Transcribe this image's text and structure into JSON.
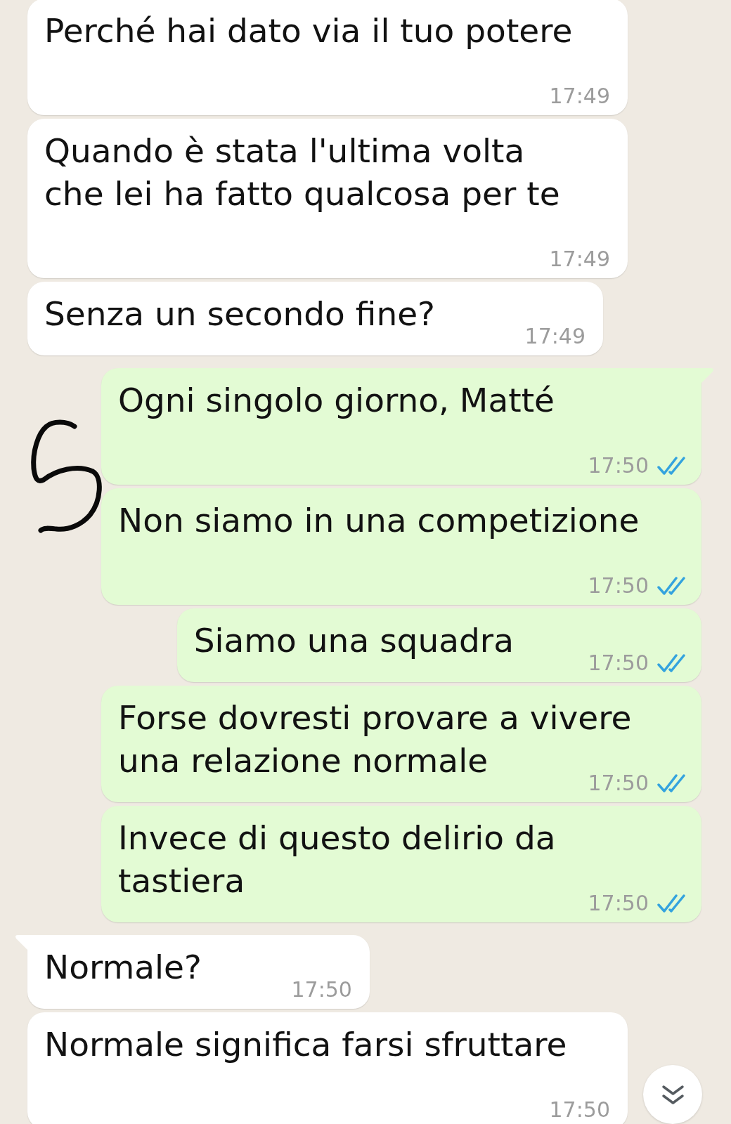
{
  "messages": [
    {
      "kind": "incoming",
      "tail": false,
      "text": "Perché hai dato via il tuo potere",
      "time": "17:49"
    },
    {
      "kind": "incoming",
      "tail": false,
      "text": "Quando è stata l'ultima volta che lei ha fatto qualcosa per te",
      "time": "17:49"
    },
    {
      "kind": "incoming",
      "tail": false,
      "text": "Senza un secondo fine?",
      "time": "17:49"
    },
    {
      "kind": "outgoing",
      "tail": true,
      "text": "Ogni singolo giorno, Matté",
      "time": "17:50",
      "read": true
    },
    {
      "kind": "outgoing",
      "tail": false,
      "text": "Non siamo in una competizione",
      "time": "17:50",
      "read": true
    },
    {
      "kind": "outgoing",
      "tail": false,
      "text": "Siamo una squadra",
      "time": "17:50",
      "read": true
    },
    {
      "kind": "outgoing",
      "tail": false,
      "text": "Forse dovresti provare a vivere una relazione normale",
      "time": "17:50",
      "read": true
    },
    {
      "kind": "outgoing",
      "tail": false,
      "text": "Invece di questo delirio da tastiera",
      "time": "17:50",
      "read": true
    },
    {
      "kind": "incoming",
      "tail": true,
      "text": "Normale?",
      "time": "17:50"
    },
    {
      "kind": "incoming",
      "tail": false,
      "text": "Normale significa farsi sfruttare",
      "time": "17:50"
    }
  ]
}
